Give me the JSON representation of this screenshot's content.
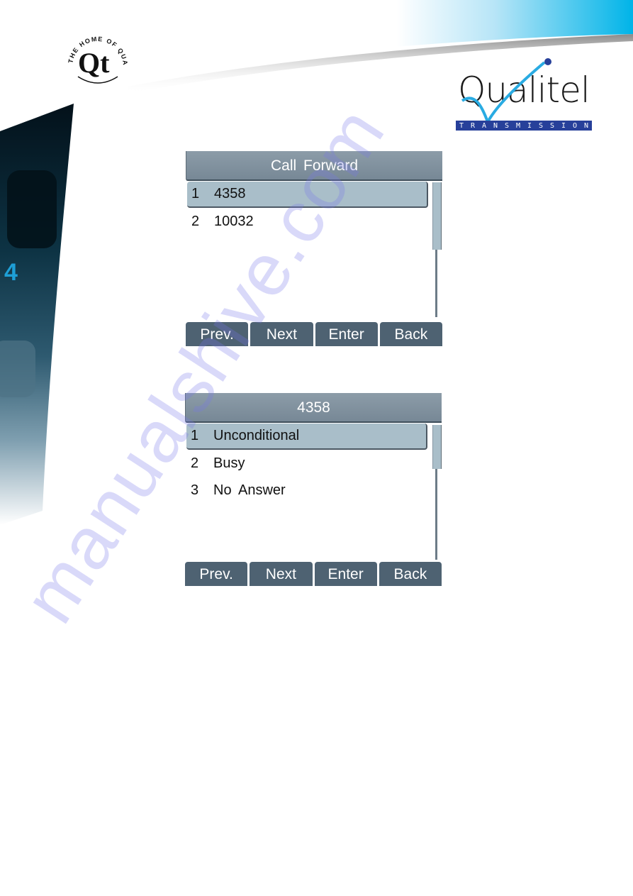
{
  "branding": {
    "qt_logo": {
      "letters": "Qt",
      "arc_text": "THE HOME OF QUALITY"
    },
    "qualitel_logo": {
      "word": "Qualitel",
      "tagline_letters": [
        "T",
        "R",
        "A",
        "N",
        "S",
        "M",
        "I",
        "S",
        "S",
        "I",
        "O",
        "N"
      ],
      "colors": {
        "band": "#27409a",
        "check": "#29abe2",
        "dot": "#27409a"
      }
    },
    "header_gradient_colors": [
      "#ffffff",
      "#00b4e8"
    ]
  },
  "screens": [
    {
      "title": "Call Forward",
      "items": [
        {
          "num": "1",
          "label": "4358",
          "selected": true
        },
        {
          "num": "2",
          "label": "10032",
          "selected": false
        }
      ],
      "softkeys": [
        "Prev.",
        "Next",
        "Enter",
        "Back"
      ]
    },
    {
      "title": "4358",
      "items": [
        {
          "num": "1",
          "label": "Unconditional",
          "selected": true
        },
        {
          "num": "2",
          "label": "Busy",
          "selected": false
        },
        {
          "num": "3",
          "label": "No Answer",
          "selected": false
        }
      ],
      "softkeys": [
        "Prev.",
        "Next",
        "Enter",
        "Back"
      ]
    }
  ],
  "colors": {
    "title_bar": "#7f909d",
    "selected_item": "#a9bec9",
    "softkey": "#4e6272",
    "watermark": "#7878eb"
  },
  "watermark": "manualshive.com"
}
